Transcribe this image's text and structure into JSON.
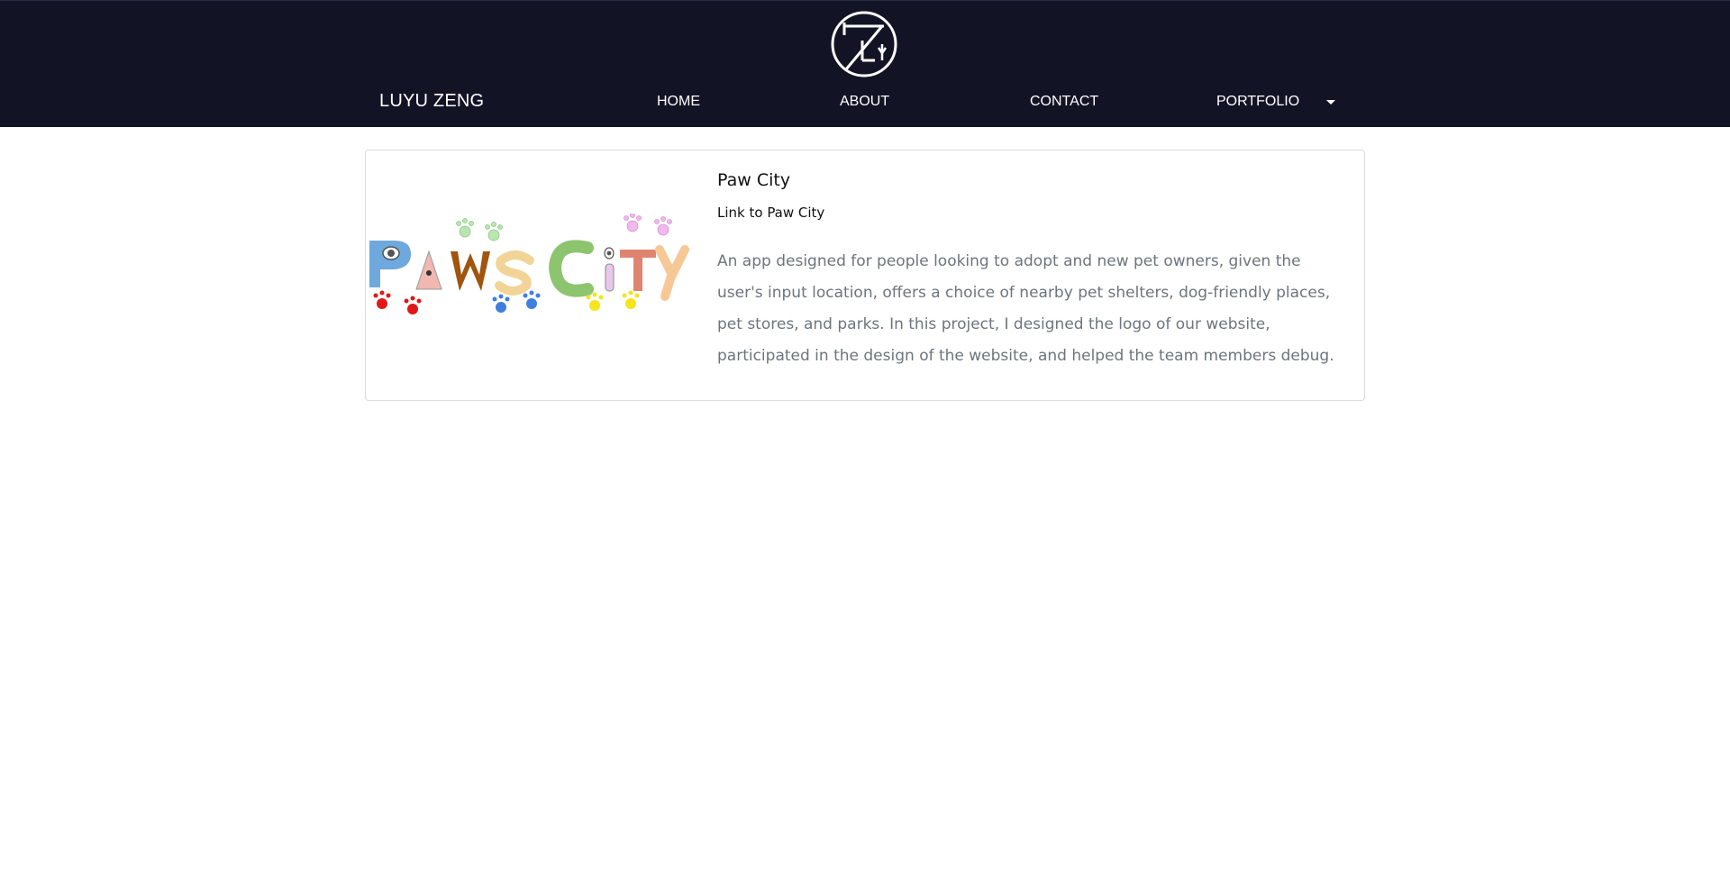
{
  "header": {
    "logo_icon": "lz-monogram-icon",
    "brand": "LUYU ZENG",
    "background": "#121426",
    "nav": {
      "home": "HOME",
      "about": "ABOUT",
      "contact": "CONTACT",
      "portfolio": "PORTFOLIO"
    }
  },
  "project": {
    "title": "Paw City",
    "link_text": "Link to Paw City",
    "logo_text": "PawsCity",
    "description": "An app designed for people looking to adopt and new pet owners, given the user's input location, offers a choice of nearby pet shelters, dog-friendly places, pet stores, and parks. In this project, I designed the logo of our website, participated in the design of the website, and helped the team members debug."
  }
}
